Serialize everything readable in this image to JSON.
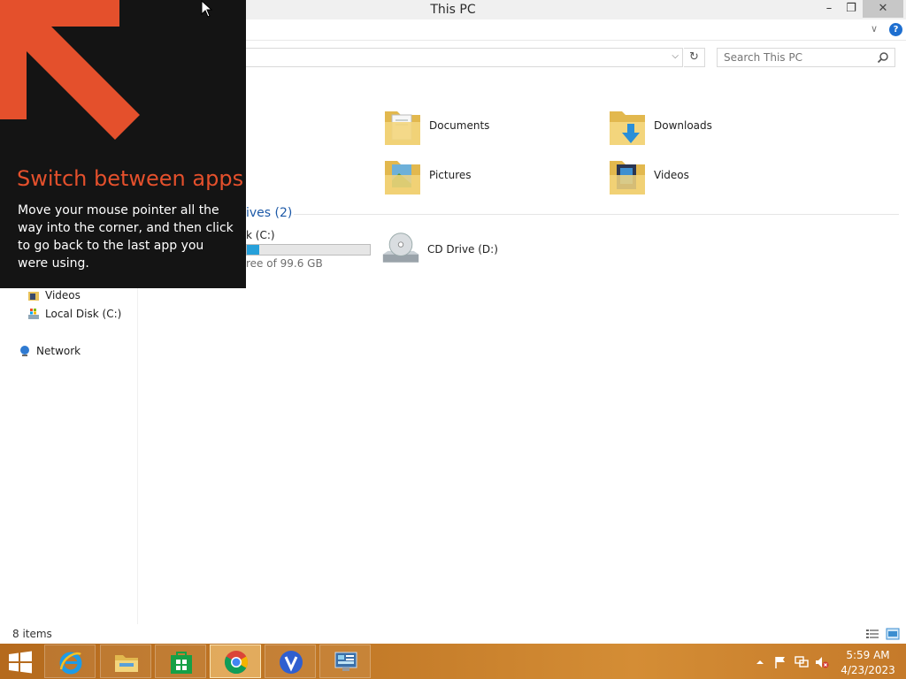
{
  "window": {
    "title": "This PC",
    "controls": {
      "minimize": "–",
      "maximize": "❐",
      "close": "✕"
    }
  },
  "search": {
    "placeholder": "Search This PC"
  },
  "nav": {
    "items": [
      {
        "label": "Videos",
        "icon": "video-folder-icon"
      },
      {
        "label": "Local Disk (C:)",
        "icon": "local-disk-icon"
      },
      {
        "label": "Network",
        "icon": "network-icon"
      }
    ]
  },
  "folders": [
    {
      "label": "Documents",
      "icon": "documents-folder-icon"
    },
    {
      "label": "Downloads",
      "icon": "downloads-folder-icon"
    },
    {
      "label": "Pictures",
      "icon": "pictures-folder-icon"
    },
    {
      "label": "Videos",
      "icon": "videos-folder-icon"
    }
  ],
  "drives_group": {
    "label": "ives (2)"
  },
  "drives": {
    "local": {
      "name": "k (C:)",
      "free_text": "ree of 99.6 GB",
      "used_fraction": 0.1
    },
    "cd": {
      "label": "CD Drive (D:)",
      "icon": "cd-drive-icon"
    }
  },
  "status": {
    "count": "8 items"
  },
  "tip": {
    "title": "Switch between apps",
    "body": "Move your mouse pointer all the way into the corner, and then click to go back to the last app you were using."
  },
  "taskbar": {
    "apps": [
      {
        "name": "Internet Explorer",
        "icon": "ie-icon"
      },
      {
        "name": "File Explorer",
        "icon": "file-explorer-icon"
      },
      {
        "name": "Store",
        "icon": "store-icon"
      },
      {
        "name": "Chrome",
        "icon": "chrome-icon",
        "active": true
      },
      {
        "name": "V app",
        "icon": "v-app-icon"
      },
      {
        "name": "Control Panel",
        "icon": "control-panel-icon"
      }
    ],
    "clock": {
      "time": "5:59 AM",
      "date": "4/23/2023"
    }
  },
  "colors": {
    "accent": "#e4502c",
    "link_blue": "#1e5aa8",
    "taskbar": "#c37a28",
    "drive_fill": "#26a0da"
  }
}
